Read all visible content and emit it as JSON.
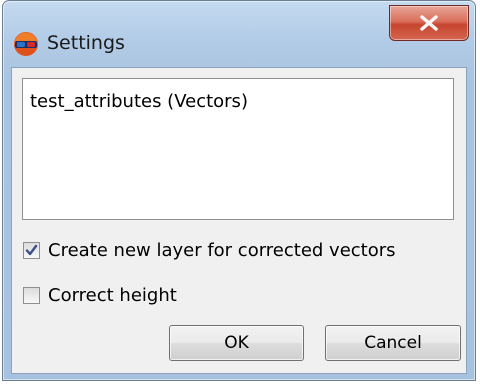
{
  "window": {
    "title": "Settings"
  },
  "layer_list": {
    "items": [
      "test_attributes (Vectors)"
    ]
  },
  "options": {
    "create_new_layer": {
      "label": "Create new layer for corrected vectors",
      "checked": true
    },
    "correct_height": {
      "label": "Correct height",
      "checked": false
    }
  },
  "buttons": {
    "ok_label": "OK",
    "cancel_label": "Cancel"
  },
  "icons": {
    "app": "app-3d-glasses-icon",
    "close": "close-x-icon",
    "check": "checkmark-icon"
  },
  "colors": {
    "title_bar": "#b2cbe6",
    "close_button": "#c7452f",
    "dialog_background": "#f0f0f0"
  }
}
